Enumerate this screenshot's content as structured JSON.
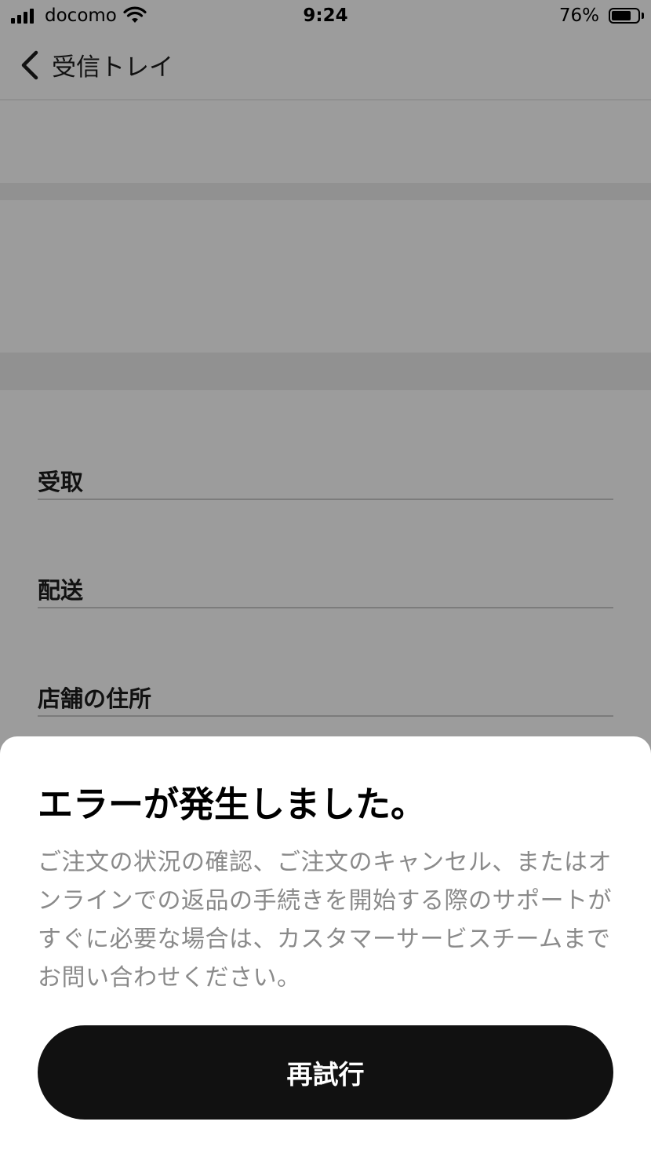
{
  "status_bar": {
    "carrier": "docomo",
    "time": "9:24",
    "battery_percent": "76%",
    "battery_level": 0.76,
    "signal_bars": 4,
    "wifi_icon": "wifi-icon"
  },
  "nav": {
    "back_icon": "chevron-left-icon",
    "title": "受信トレイ"
  },
  "sections": [
    {
      "label": "受取"
    },
    {
      "label": "配送"
    },
    {
      "label": "店舗の住所"
    }
  ],
  "error_sheet": {
    "title": "エラーが発生しました。",
    "message": "ご注文の状況の確認、ご注文のキャンセル、またはオンラインでの返品の手続きを開始する際のサポートがすぐに必要な場合は、カスタマーサービスチームまでお問い合わせください。",
    "retry_label": "再試行"
  },
  "colors": {
    "overlay": "#9c9c9c",
    "sheet_bg": "#ffffff",
    "button_bg": "#111111",
    "message_text": "#8a8a8a"
  }
}
